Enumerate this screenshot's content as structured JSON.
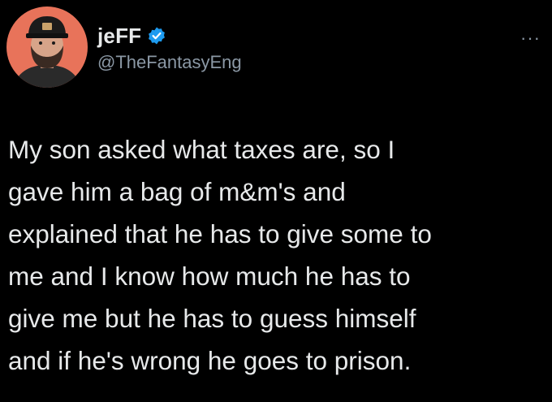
{
  "author": {
    "display_name": "jeFF",
    "handle": "@TheFantasyEng",
    "verified": true,
    "verified_icon": "verified-badge-icon",
    "avatar_icon": "avatar-man-with-cap-icon"
  },
  "menu": {
    "more_icon": "more-options-icon",
    "more_label": "···"
  },
  "tweet": {
    "text": "My son asked what taxes are, so I\ngave him a bag of m&m's and\nexplained that he has to give some to\nme and I know how much he has to\ngive me but he has to guess himself\nand if he's wrong he goes to prison."
  },
  "colors": {
    "background": "#000000",
    "text_primary": "#e7e9ea",
    "text_secondary": "#8b98a5",
    "verified_blue": "#1d9bf0",
    "avatar_bg": "#e8735a"
  }
}
